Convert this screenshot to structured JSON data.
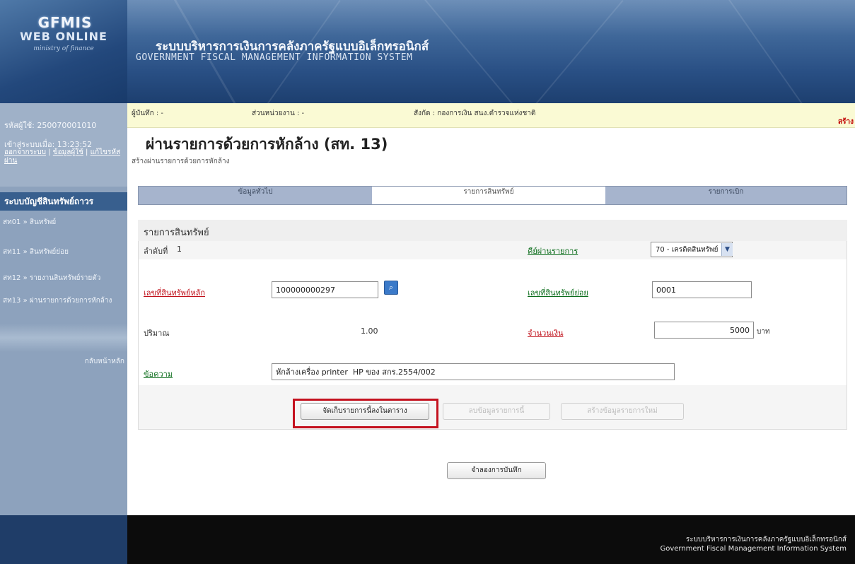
{
  "header": {
    "logo_line1": "GFMIS",
    "logo_line2": "WEB ONLINE",
    "logo_line3": "ministry of finance",
    "system_title_th": "ระบบบริหารการเงินการคลังภาครัฐแบบอิเล็กทรอนิกส์",
    "system_title_en": "GOVERNMENT FISCAL MANAGEMENT INFORMATION SYSTEM"
  },
  "sidebar": {
    "user_id": "รหัสผู้ใช้: 250070001010",
    "login_time": "เข้าสู่ระบบเมื่อ: 13:23:52",
    "links": [
      "ออกจากระบบ",
      "ข้อมูลผู้ใช้",
      "แก้ไขรหัสผ่าน"
    ],
    "menu_title": "ระบบบัญชีสินทรัพย์ถาวร",
    "menu_items": [
      "สท01 » สินทรัพย์",
      "สท11 » สินทรัพย์ย่อย",
      "สท12 » รายงานสินทรัพย์รายตัว",
      "สท13 » ผ่านรายการด้วยการหักล้าง"
    ],
    "back_main": "กลับหน้าหลัก"
  },
  "info_bar": {
    "recorder": "ผู้บันทึก : -",
    "unit": "ส่วนหน่วยงาน : -",
    "affiliation": "สังกัด : กองการเงิน สนง.ตำรวจแห่งชาติ",
    "action": "สร้าง"
  },
  "page": {
    "title": "ผ่านรายการด้วยการหักล้าง (สท. 13)",
    "subtitle": "สร้างผ่านรายการด้วยการหักล้าง"
  },
  "tabs": [
    "ข้อมูลทั่วไป",
    "รายการสินทรัพย์",
    "รายการเบิก"
  ],
  "form": {
    "section_title": "รายการสินทรัพย์",
    "seq_label": "ลำดับที่",
    "seq_value": "1",
    "posting_key_label": "คีย์ผ่านรายการ",
    "posting_key_value": "70 - เครดิตสินทรัพย์",
    "main_asset_label": "เลขที่สินทรัพย์หลัก",
    "main_asset_value": "100000000297",
    "sub_asset_label": "เลขที่สินทรัพย์ย่อย",
    "sub_asset_value": "0001",
    "quantity_label": "ปริมาณ",
    "quantity_value": "1.00",
    "amount_label": "จำนวนเงิน",
    "amount_value": "5000",
    "currency": "บาท",
    "text_label": "ข้อความ",
    "text_value": "หักล้างเครื่อง printer  HP ของ สกร.2554/002"
  },
  "buttons": {
    "save_to_table": "จัดเก็บรายการนี้ลงในตาราง",
    "delete_item": "ลบข้อมูลรายการนี้",
    "new_item": "สร้างข้อมูลรายการใหม่",
    "simulate_save": "จำลองการบันทึก"
  },
  "footer": {
    "line_th": "ระบบบริหารการเงินการคลังภาครัฐแบบอิเล็กทรอนิกส์",
    "line_en": "Government Fiscal Management Information System"
  },
  "colors": {
    "highlight": "#c4121f",
    "link_red": "#c0101a",
    "link_green": "#0a6c1a",
    "menu_title_bg": "#385f8e"
  }
}
